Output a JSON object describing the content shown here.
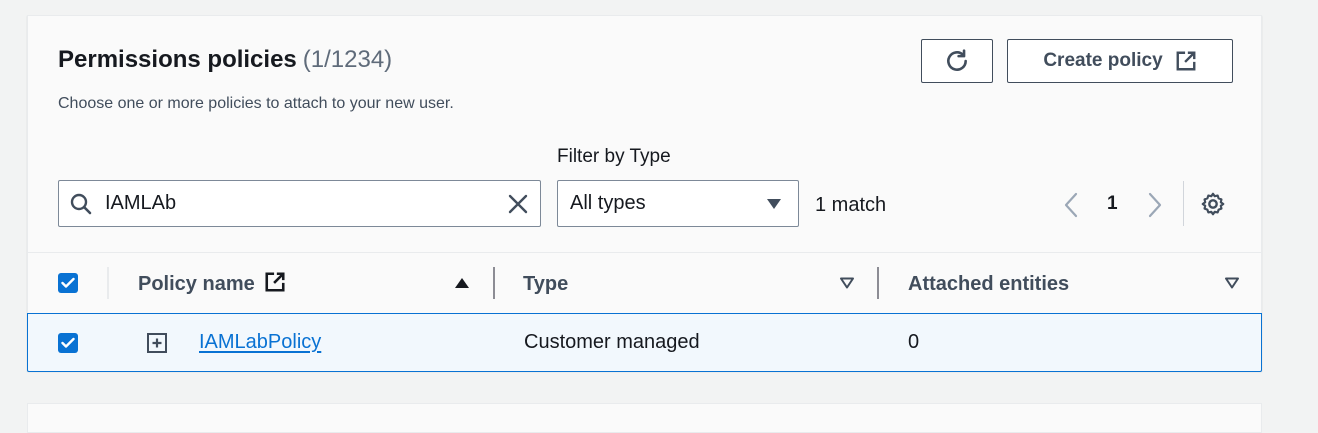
{
  "header": {
    "title": "Permissions policies",
    "count": "(1/1234)",
    "description": "Choose one or more policies to attach to your new user."
  },
  "actions": {
    "refresh_icon": "refresh-icon",
    "create_label": "Create policy",
    "create_icon": "external-link-icon"
  },
  "filters": {
    "filter_label": "Filter by Type",
    "search_value": "IAMLAb",
    "type_selected": "All types",
    "match_text": "1 match"
  },
  "pagination": {
    "current_page": "1"
  },
  "table": {
    "columns": [
      {
        "label": "Policy name",
        "sort": "ascending"
      },
      {
        "label": "Type",
        "sort": "none"
      },
      {
        "label": "Attached entities",
        "sort": "none"
      }
    ],
    "rows": [
      {
        "checked": true,
        "policy_name": "IAMLabPolicy",
        "type": "Customer managed",
        "attached_entities": "0"
      }
    ],
    "select_all_checked": true
  },
  "colors": {
    "accent": "#0972d3",
    "text": "#16191f",
    "muted": "#5f6b7a",
    "row_selected_bg": "#f2f8fd"
  }
}
